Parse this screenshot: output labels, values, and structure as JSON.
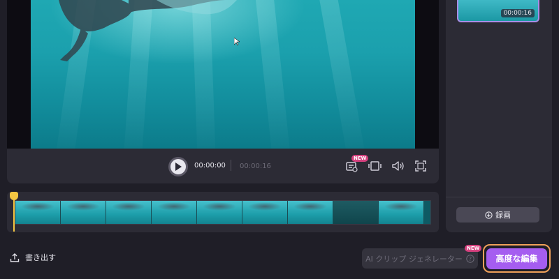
{
  "player": {
    "current_time": "00:00:00",
    "total_time": "00:00:16",
    "controls": {
      "play_icon": "play-icon",
      "captions_icon": "captions-icon",
      "captions_badge": "NEW",
      "aspect_icon": "aspect-ratio-icon",
      "volume_icon": "volume-icon",
      "fullscreen_icon": "fullscreen-icon"
    }
  },
  "side_panel": {
    "clip_duration": "00:00:16",
    "record_label": "録画",
    "record_icon": "plus-circle-icon"
  },
  "bottom_bar": {
    "export_label": "書き出す",
    "export_icon": "upload-icon",
    "ai_label": "AI クリップ ジェネレーター",
    "ai_badge": "NEW",
    "ai_help_icon": "help-circle-icon",
    "advanced_label": "高度な編集"
  },
  "colors": {
    "accent": "#a55df0",
    "accent_border": "#f0a15a",
    "playhead": "#f5c742",
    "new_badge": "#d6417f"
  }
}
